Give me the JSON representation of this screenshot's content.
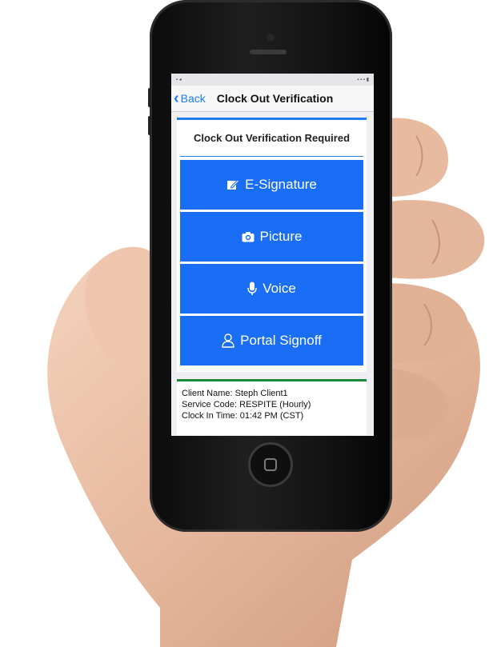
{
  "nav": {
    "back_label": "Back",
    "title": "Clock Out Verification"
  },
  "verification": {
    "heading": "Clock Out Verification Required",
    "options": [
      {
        "label": "E-Signature",
        "icon": "edit-icon"
      },
      {
        "label": "Picture",
        "icon": "camera-icon"
      },
      {
        "label": "Voice",
        "icon": "microphone-icon"
      },
      {
        "label": "Portal Signoff",
        "icon": "user-icon"
      }
    ]
  },
  "client_info": {
    "client_name": "Client Name: Steph Client1",
    "service_code": "Service Code: RESPITE (Hourly)",
    "clock_in_time": "Clock In Time: 01:42 PM (CST)"
  },
  "colors": {
    "accent_blue": "#1a6ef5",
    "link_blue": "#1e7cf2",
    "success_green": "#1b8a3c"
  }
}
